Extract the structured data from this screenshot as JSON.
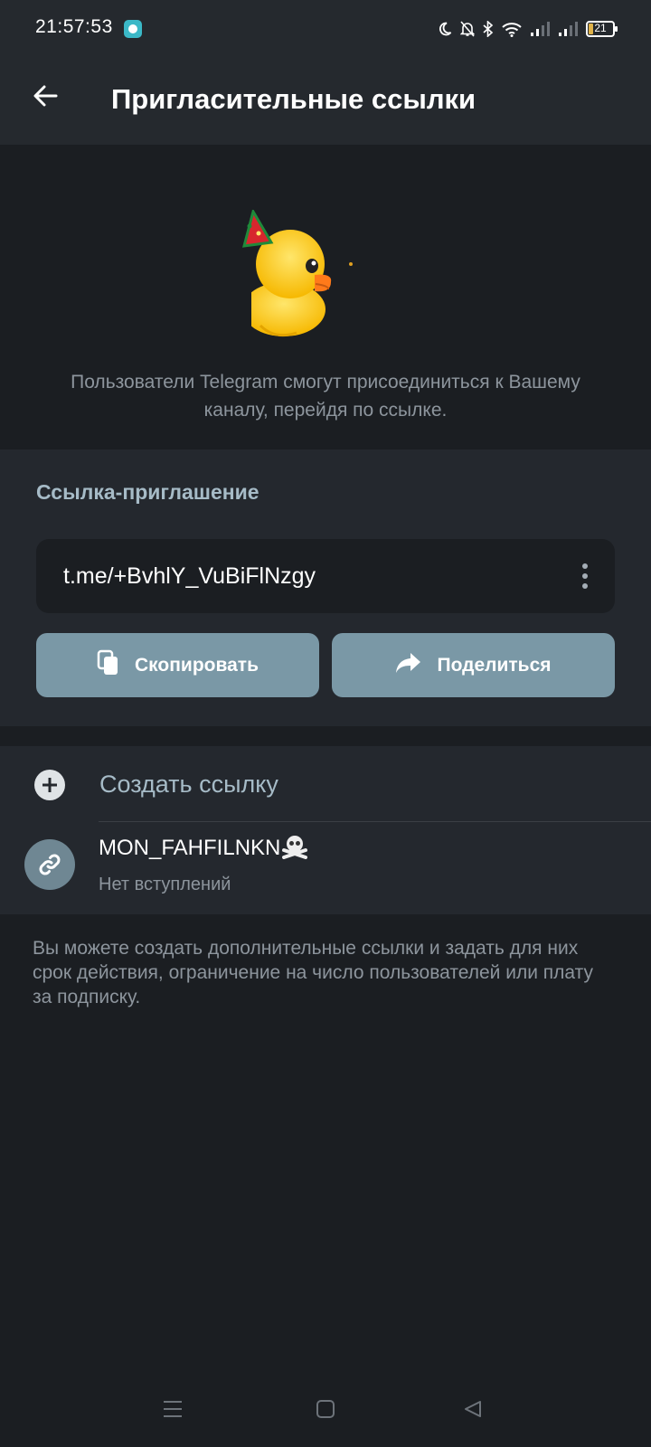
{
  "status_bar": {
    "time": "21:57:53",
    "battery_level": "21",
    "icons": [
      "notification-app-icon",
      "moon-icon",
      "bell-off-icon",
      "bluetooth-icon",
      "wifi-icon",
      "signal-icon",
      "signal-icon",
      "battery-icon"
    ]
  },
  "header": {
    "title": "Пригласительные ссылки",
    "back_icon": "arrow-left-icon"
  },
  "hero": {
    "sticker": "duck-party-hat-sticker",
    "description": "Пользователи Telegram смогут присоединиться к Вашему каналу, перейдя по ссылке."
  },
  "invite_section": {
    "header": "Ссылка-приглашение",
    "link": "t.me/+BvhlY_VuBiFlNzgy",
    "copy_label": "Скопировать",
    "share_label": "Поделиться"
  },
  "links_list": {
    "create_label": "Создать ссылку",
    "items": [
      {
        "name": "MON_FAHFILNKN",
        "status": "Нет вступлений"
      }
    ]
  },
  "footer": {
    "note": "Вы можете создать дополнительные ссылки и задать для них срок действия, ограничение на число пользователей или плату за подписку."
  },
  "colors": {
    "background": "#1b1e22",
    "surface": "#24282e",
    "header": "#25292e",
    "accent": "#7a98a6",
    "accent_text": "#a6bbc7",
    "secondary_text": "#8d959d"
  }
}
